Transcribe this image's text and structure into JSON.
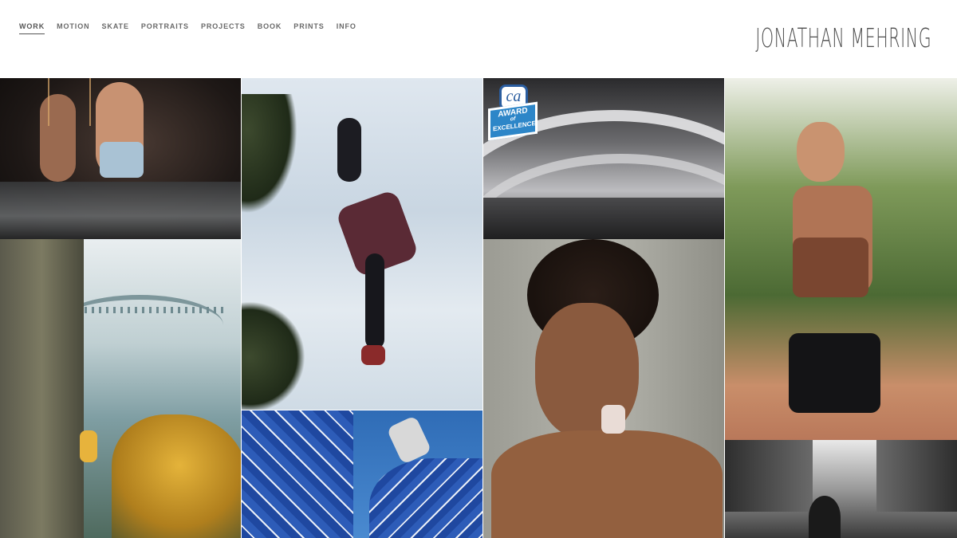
{
  "brand": {
    "name": "JONATHAN MEHRING"
  },
  "nav": {
    "items": [
      {
        "label": "WORK",
        "active": true
      },
      {
        "label": "MOTION"
      },
      {
        "label": "SKATE"
      },
      {
        "label": "PORTRAITS"
      },
      {
        "label": "PROJECTS"
      },
      {
        "label": "BOOK"
      },
      {
        "label": "PRINTS"
      },
      {
        "label": "INFO"
      }
    ]
  },
  "award_badge": {
    "top_text": "ca",
    "line1": "AWARD",
    "line2": "of",
    "line3": "EXCELLENCE"
  },
  "colors": {
    "nav_text": "#6a6a6a",
    "brand_text": "#4d4d4d",
    "badge_blue": "#2d86c8"
  }
}
